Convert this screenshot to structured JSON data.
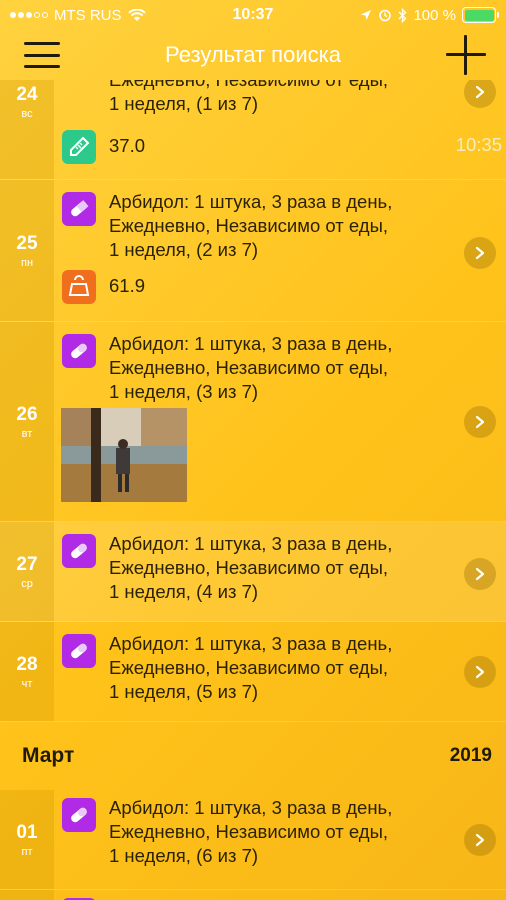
{
  "status_bar": {
    "carrier": "MTS RUS",
    "time": "10:37",
    "battery": "100 %"
  },
  "nav": {
    "title": "Результат поиска",
    "menu_icon": "hamburger-menu-icon",
    "add_icon": "plus-icon"
  },
  "days": [
    {
      "day": "24",
      "weekday": "вс",
      "entries": [
        {
          "icon": "pill-icon",
          "text": "Ежедневно, Независимо от еды,\n1 неделя, (1 из 7)"
        },
        {
          "icon": "thermometer-icon",
          "text": "37.0",
          "time": "10:35"
        }
      ]
    },
    {
      "day": "25",
      "weekday": "пн",
      "entries": [
        {
          "icon": "pill-icon",
          "text": "Арбидол: 1 штука, 3 раза в день,\nЕжедневно, Независимо от еды,\n1 неделя, (2 из 7)"
        },
        {
          "icon": "weight-icon",
          "text": "61.9"
        }
      ]
    },
    {
      "day": "26",
      "weekday": "вт",
      "entries": [
        {
          "icon": "pill-icon",
          "text": "Арбидол: 1 штука, 3 раза в день,\nЕжедневно, Независимо от еды,\n1 неделя, (3 из 7)"
        }
      ]
    },
    {
      "day": "27",
      "weekday": "ср",
      "entries": [
        {
          "icon": "pill-icon",
          "text": "Арбидол: 1 штука, 3 раза в день,\nЕжедневно, Независимо от еды,\n1 неделя, (4 из 7)"
        }
      ]
    },
    {
      "day": "28",
      "weekday": "чт",
      "entries": [
        {
          "icon": "pill-icon",
          "text": "Арбидол: 1 штука, 3 раза в день,\nЕжедневно, Независимо от еды,\n1 неделя, (5 из 7)"
        }
      ]
    },
    {
      "day": "01",
      "weekday": "пт",
      "entries": [
        {
          "icon": "pill-icon",
          "text": "Арбидол: 1 штука, 3 раза в день,\nЕжедневно, Независимо от еды,\n1 неделя, (6 из 7)"
        }
      ]
    }
  ],
  "month_header": {
    "month": "Март",
    "year": "2019"
  },
  "colors": {
    "pill": "#b12be6",
    "thermometer": "#2cc98a",
    "weight": "#f06f1f",
    "background": "#ffc21a"
  }
}
